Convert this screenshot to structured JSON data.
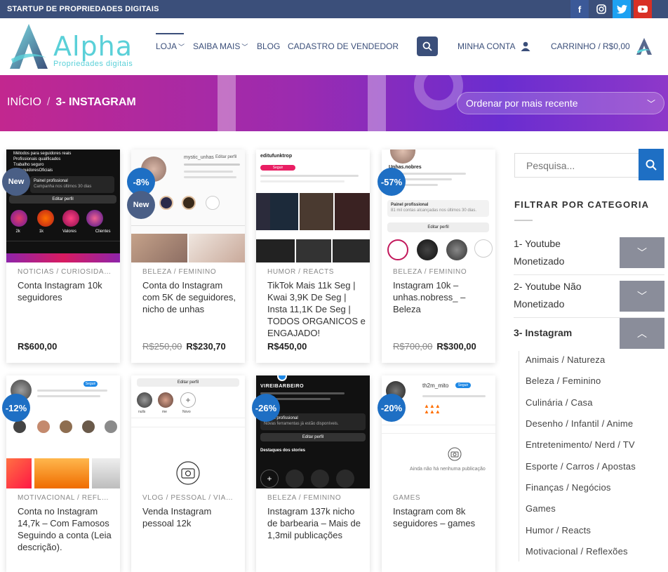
{
  "topbar": {
    "tagline": "STARTUP DE PROPRIEDADES DIGITAIS"
  },
  "header": {
    "logo_word": "Alpha",
    "logo_sub": "Propriedades digitais",
    "nav": {
      "loja": "LOJA",
      "saiba": "SAIBA MAIS",
      "blog": "BLOG",
      "cadastro": "CADASTRO DE VENDEDOR",
      "conta": "MINHA CONTA",
      "cart": "CARRINHO / R$0,00"
    }
  },
  "banner": {
    "crumb_home": "INÍCIO",
    "crumb_sep": "/",
    "crumb_current": "3- INSTAGRAM",
    "sort_value": "Ordenar por mais recente"
  },
  "products": [
    {
      "category": "NOTICIAS / CURIOSIDAD...",
      "title": "Conta Instagram 10k seguidores",
      "price": "R$600,00",
      "old_price": "",
      "badge": "New"
    },
    {
      "category": "BELEZA / FEMININO",
      "title": "Conta do Instagram com 5K de seguidores, nicho de unhas",
      "price": "R$230,70",
      "old_price": "R$250,00",
      "badge": "-8%",
      "badge2": "New"
    },
    {
      "category": "HUMOR / REACTS",
      "title": "TikTok Mais 11k Seg | Kwai 3,9K De Seg | Insta 11,1K De Seg | TODOS ORGANICOS e ENGAJADO!",
      "price": "R$450,00",
      "old_price": "",
      "badge": ""
    },
    {
      "category": "BELEZA / FEMININO",
      "title": "Instagram 10k – unhas.nobress_ – Beleza",
      "price": "R$300,00",
      "old_price": "R$700,00",
      "badge": "-57%"
    },
    {
      "category": "MOTIVACIONAL / REFLEX...",
      "title": "Conta no Instagram 14,7k – Com Famosos Seguindo a conta (Leia descrição).",
      "price": "",
      "old_price": "",
      "badge": "-12%"
    },
    {
      "category": "VLOG / PESSOAL / VIAGE...",
      "title": "Venda Instagram pessoal 12k",
      "price": "",
      "old_price": "",
      "badge": ""
    },
    {
      "category": "BELEZA / FEMININO",
      "title": "Instagram 137k nicho de barbearia – Mais de 1,3mil publicações",
      "price": "",
      "old_price": "",
      "badge": "-26%"
    },
    {
      "category": "GAMES",
      "title": "Instagram com 8k seguidores – games",
      "price": "",
      "old_price": "",
      "badge": "-20%"
    }
  ],
  "thumbs": {
    "t1_lines": [
      "Métodos para seguidores reais",
      "Profissionais qualificados",
      "Trabalho seguro",
      "@SeguidoresOficiais"
    ],
    "t1_panel": "Painel profissional",
    "t1_panel_sub": "Campanha nos últimos 30 dias",
    "t1_edit": "Editar perfil",
    "t1_highlights": [
      "2k",
      "1k",
      "Valores",
      "Clientes"
    ],
    "t2_user": "mystic_unhas",
    "t2_edit": "Editar perfil",
    "t3_user": "editufunktrop",
    "t3_follow": "Seguir",
    "t4_user": "Unhas.nobres",
    "t4_panel": "Painel profissional",
    "t4_panel_sub": "81 mil contas alcançadas nos últimos 30 dias.",
    "t4_edit": "Editar perfil",
    "t5_follow": "Seguir",
    "t6_edit": "Editar perfil",
    "t6_hl": [
      "nulls",
      "me",
      "Novo"
    ],
    "t7_user": "VIREIBARBEIRO",
    "t7_panel": "Painel profissional",
    "t7_panel_sub": "Novas ferramentas já estão disponíveis.",
    "t7_edit": "Editar perfil",
    "t7_stories": "Destaques dos stories",
    "t8_user": "th2m_mito",
    "t8_follow": "Seguir",
    "t8_empty": "Ainda não há nenhuma publicação"
  },
  "sidebar": {
    "search_placeholder": "Pesquisa...",
    "heading": "FILTRAR POR CATEGORIA",
    "categories": [
      {
        "label": "1- Youtube Monetizado"
      },
      {
        "label": "2- Youtube Não Monetizado"
      },
      {
        "label": "3- Instagram"
      }
    ],
    "subcategories": [
      "Animais / Natureza",
      "Beleza / Feminino",
      "Culinária / Casa",
      "Desenho / Infantil / Anime",
      "Entretenimento/ Nerd / TV",
      "Esporte / Carros / Apostas",
      "Finanças / Negócios",
      "Games",
      "Humor / Reacts",
      "Motivacional / Reflexões"
    ]
  },
  "colors": {
    "brand": "#3b4f7a",
    "accent": "#1e6fc4",
    "logo": "#5ad0d8"
  },
  "icons": {
    "search": "search-icon",
    "user": "user-icon",
    "chevron": "chevron-down-icon"
  }
}
